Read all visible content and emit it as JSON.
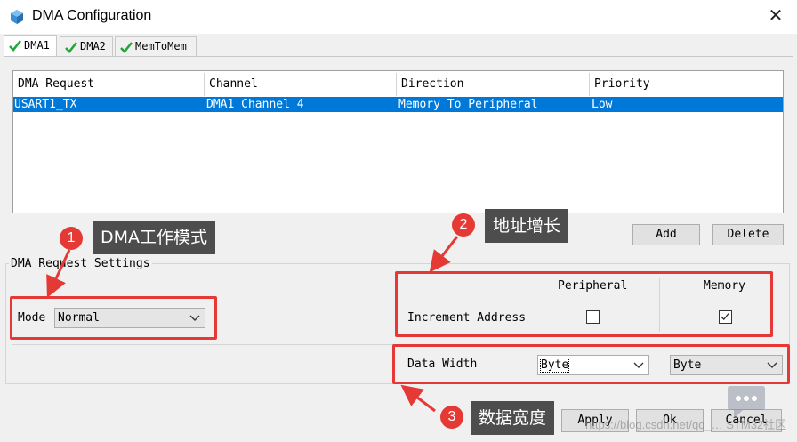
{
  "window": {
    "title": "DMA Configuration",
    "close_glyph": "✕"
  },
  "tabs": [
    {
      "label": "DMA1",
      "active": true
    },
    {
      "label": "DMA2",
      "active": false
    },
    {
      "label": "MemToMem",
      "active": false
    }
  ],
  "table": {
    "columns": [
      "DMA Request",
      "Channel",
      "Direction",
      "Priority"
    ],
    "rows": [
      {
        "request": "USART1_TX",
        "channel": "DMA1 Channel 4",
        "direction": "Memory To Peripheral",
        "priority": "Low",
        "selected": true
      }
    ]
  },
  "buttons": {
    "add": "Add",
    "delete": "Delete",
    "apply": "Apply",
    "ok": "Ok",
    "cancel": "Cancel"
  },
  "settings": {
    "group_label": "DMA Request Settings",
    "mode_label": "Mode",
    "mode_value": "Normal",
    "peripheral_header": "Peripheral",
    "memory_header": "Memory",
    "increment_label": "Increment Address",
    "increment_peripheral": false,
    "increment_memory": true,
    "data_width_label": "Data Width",
    "data_width_peripheral": "Byte",
    "data_width_memory": "Byte"
  },
  "annotations": [
    {
      "number": "1",
      "text": "DMA工作模式"
    },
    {
      "number": "2",
      "text": "地址增长"
    },
    {
      "number": "3",
      "text": "数据宽度"
    }
  ],
  "watermark": "https://blog.csdn.net/qq_… STM32社区",
  "colors": {
    "accent_selection": "#0078d7",
    "annotation_red": "#e53935",
    "callout_bg": "#4d4d4d",
    "check_green": "#22a83a"
  },
  "icons": [
    "app-cube-icon",
    "close-icon",
    "tab-check-icon",
    "chevron-down-icon",
    "checkmark-icon",
    "chat-bubble-icon"
  ]
}
